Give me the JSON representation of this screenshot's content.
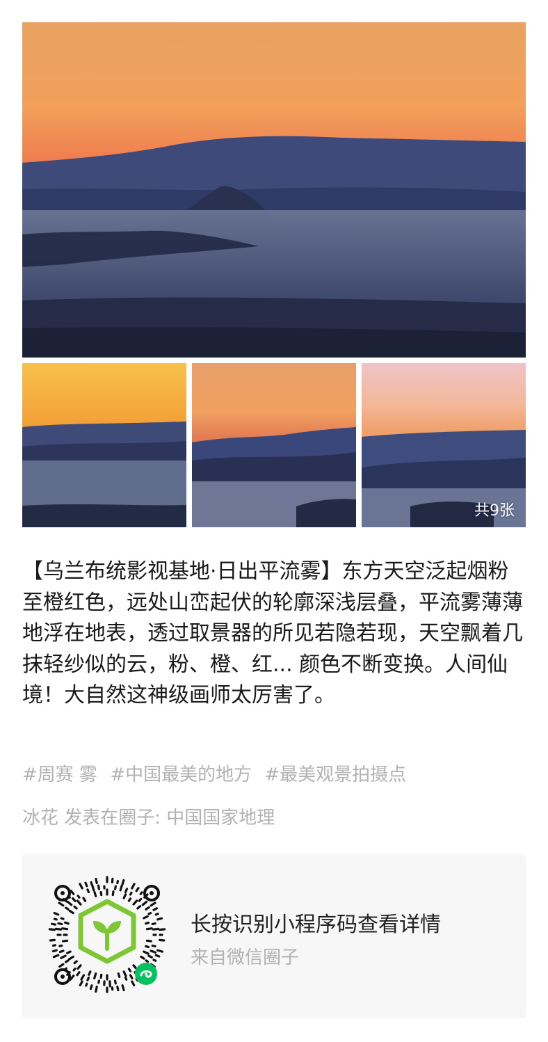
{
  "colors": {
    "body_text": "#1a1a1a",
    "muted_text": "#b2b2b2",
    "card_bg": "#f7f7f7",
    "mini_program_green": "#7cc733",
    "mini_program_badge": "#07c160"
  },
  "gallery": {
    "photo_count_label": "共9张",
    "images": [
      {
        "icon": "sunrise-mountain-fog-photo"
      },
      {
        "icon": "sunrise-mountain-fog-photo"
      },
      {
        "icon": "sunrise-mountain-fog-photo"
      },
      {
        "icon": "sunrise-mountain-fog-photo"
      }
    ]
  },
  "post": {
    "caption": "【乌兰布统影视基地·日出平流雾】东方天空泛起烟粉至橙红色，远处山峦起伏的轮廓深浅层叠，平流雾薄薄地浮在地表，透过取景器的所见若隐若现，天空飘着几抹轻纱似的云，粉、橙、红... 颜色不断变换。人间仙境！大自然这神级画师太厉害了。",
    "tags": [
      "#周赛 雾",
      "#中国最美的地方",
      "#最美观景拍摄点"
    ],
    "author_line": "冰花 发表在圈子: 中国国家地理"
  },
  "mini_program": {
    "title": "长按识别小程序码查看详情",
    "subtitle": "来自微信圈子"
  }
}
